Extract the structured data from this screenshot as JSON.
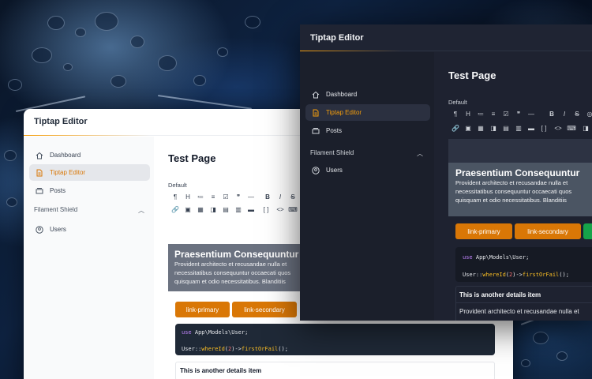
{
  "background": {
    "description_colors": [
      "#0b1320",
      "#0e2240",
      "#5f9bd6"
    ]
  },
  "light": {
    "brand": "Tiptap Editor",
    "nav": [
      {
        "label": "Dashboard",
        "icon": "home-icon"
      },
      {
        "label": "Tiptap Editor",
        "icon": "document-icon",
        "active": true
      },
      {
        "label": "Posts",
        "icon": "stack-icon"
      }
    ],
    "group": {
      "label": "Filament Shield",
      "items": [
        {
          "label": "Users",
          "icon": "user-circle-icon"
        }
      ]
    },
    "page_title": "Test Page",
    "field_label": "Default",
    "toolbar_row1": [
      "¶",
      "H",
      "≔",
      "≡",
      "☑",
      "❞",
      "—",
      "B",
      "I",
      "S"
    ],
    "toolbar_row2": [
      "🔗",
      "▣",
      "▦",
      "◨",
      "▤",
      "▥",
      "⊞",
      "▬",
      "[ ]",
      "<>",
      "⌨"
    ],
    "hero_heading": "Praesentium Consequuntur",
    "hero_text_lines": [
      "Provident architecto et recusandae nulla et",
      "necessitatibus consequuntur occaecati quos",
      "quisquam et odio necessitatibus. Blanditiis"
    ],
    "buttons": [
      "link-primary",
      "link-secondary"
    ],
    "code": {
      "line1_kw": "use",
      "line1_rest": "App\\Models\\User;",
      "line2_cls": "User::",
      "line2_fn1": "whereId",
      "line2_num": "2",
      "line2_fn2": "firstOrFail",
      "line2_end": "();"
    },
    "details_title": "This is another details item"
  },
  "dark": {
    "brand": "Tiptap Editor",
    "nav": [
      {
        "label": "Dashboard",
        "icon": "home-icon"
      },
      {
        "label": "Tiptap Editor",
        "icon": "document-icon",
        "active": true
      },
      {
        "label": "Posts",
        "icon": "stack-icon"
      }
    ],
    "group": {
      "label": "Filament Shield",
      "items": [
        {
          "label": "Users",
          "icon": "user-circle-icon"
        }
      ]
    },
    "page_title": "Test Page",
    "field_label": "Default",
    "hero_heading": "Praesentium Consequuntur",
    "hero_text_lines": [
      "Provident architecto et recusandae nulla et",
      "necessitatibus consequuntur occaecati quos",
      "quisquam et odio necessitatibus. Blanditiis"
    ],
    "buttons": [
      "link-primary",
      "link-secondary"
    ],
    "code": {
      "line1_kw": "use",
      "line1_rest": "App\\Models\\User;",
      "line2_cls": "User::",
      "line2_fn1": "whereId",
      "line2_num": "2",
      "line2_fn2": "firstOrFail",
      "line2_end": "();"
    },
    "details_title": "This is another details item",
    "details_body": "Provident architecto et recusandae nulla et"
  },
  "colors": {
    "accent": "#d97706",
    "accent_light": "#f59e0b",
    "dark_bg": "#1e2230",
    "light_bg": "#ffffff"
  }
}
